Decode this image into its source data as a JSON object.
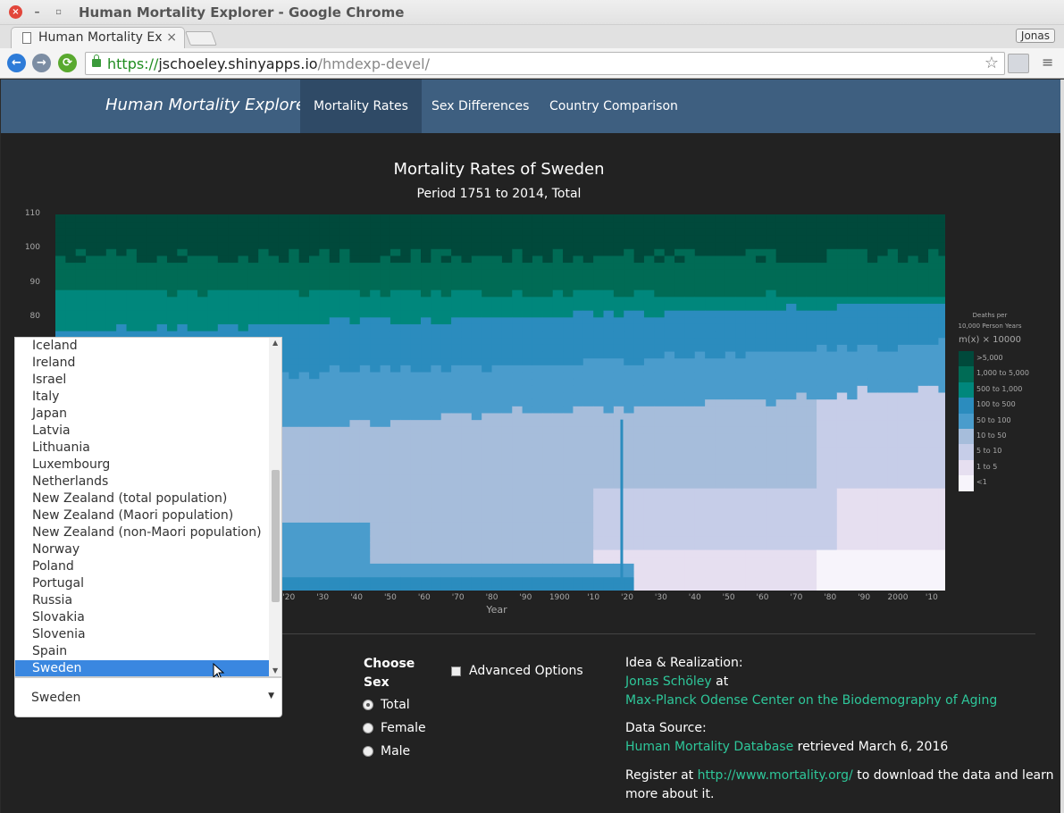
{
  "window": {
    "title": "Human Mortality Explorer - Google Chrome"
  },
  "tab": {
    "title": "Human Mortality Ex",
    "close": "×"
  },
  "profile": {
    "name": "Jonas"
  },
  "address": {
    "scheme": "https://",
    "host": "jschoeley.shinyapps.io",
    "path": "/hmdexp-devel/"
  },
  "icons": {
    "star": "☆",
    "menu": "≡",
    "back": "←",
    "forward": "→",
    "reload": "⟳",
    "close": "×",
    "minimize": "–",
    "maximize": "▫"
  },
  "app": {
    "brand": "Human Mortality Explorer",
    "nav": [
      {
        "label": "Mortality Rates",
        "active": true
      },
      {
        "label": "Sex Differences",
        "active": false
      },
      {
        "label": "Country Comparison",
        "active": false
      }
    ]
  },
  "chart_data": {
    "type": "heatmap",
    "title": "Mortality Rates of Sweden",
    "subtitle": "Period 1751 to 2014, Total",
    "xlabel": "Year",
    "ylabel": "",
    "xlim": [
      1751,
      2014
    ],
    "ylim": [
      0,
      110
    ],
    "x_ticks": [
      "'20",
      "'30",
      "'40",
      "'50",
      "'60",
      "'70",
      "'80",
      "'90",
      "1900",
      "'10",
      "'20",
      "'30",
      "'40",
      "'50",
      "'60",
      "'70",
      "'80",
      "'90",
      "2000",
      "'10"
    ],
    "x_tick_years": [
      1820,
      1830,
      1840,
      1850,
      1860,
      1870,
      1880,
      1890,
      1900,
      1910,
      1920,
      1930,
      1940,
      1950,
      1960,
      1970,
      1980,
      1990,
      2000,
      2010
    ],
    "y_ticks": [
      110,
      100,
      90,
      80
    ],
    "legend": {
      "title_top": "Deaths per",
      "title_mid": "10,000 Person Years",
      "title_formula": "m(x) × 10000",
      "classes": [
        {
          "label": ">5,000",
          "color": "#00493b"
        },
        {
          "label": "1,000 to 5,000",
          "color": "#006b55"
        },
        {
          "label": "500 to 1,000",
          "color": "#00877c"
        },
        {
          "label": "100 to 500",
          "color": "#2b8cbe"
        },
        {
          "label": "50 to 100",
          "color": "#4a9ccc"
        },
        {
          "label": "10 to 50",
          "color": "#a6bddb"
        },
        {
          "label": "5 to 10",
          "color": "#c6cde8"
        },
        {
          "label": "1 to 5",
          "color": "#e6dff0"
        },
        {
          "label": "<1",
          "color": "#f7f4fb"
        }
      ]
    }
  },
  "countries": {
    "items": [
      "Iceland",
      "Ireland",
      "Israel",
      "Italy",
      "Japan",
      "Latvia",
      "Lithuania",
      "Luxembourg",
      "Netherlands",
      "New Zealand (total population)",
      "New Zealand (Maori population)",
      "New Zealand (non-Maori population)",
      "Norway",
      "Poland",
      "Portugal",
      "Russia",
      "Slovakia",
      "Slovenia",
      "Spain",
      "Sweden"
    ],
    "selected": "Sweden"
  },
  "sex": {
    "title": "Choose Sex",
    "options": [
      "Total",
      "Female",
      "Male"
    ],
    "selected": "Total"
  },
  "advanced": {
    "label": "Advanced Options"
  },
  "about": {
    "idea_label": "Idea & Realization:",
    "author": "Jonas Schöley",
    "at": "at",
    "institution": "Max-Planck Odense Center on the Biodemography of Aging",
    "source_label": "Data Source:",
    "database": "Human Mortality Database",
    "retrieved": "retrieved March 6, 2016",
    "register_pre": "Register at",
    "register_link": "http://www.mortality.org/",
    "register_post": "to download the data and learn",
    "register_post2": "more about it."
  }
}
